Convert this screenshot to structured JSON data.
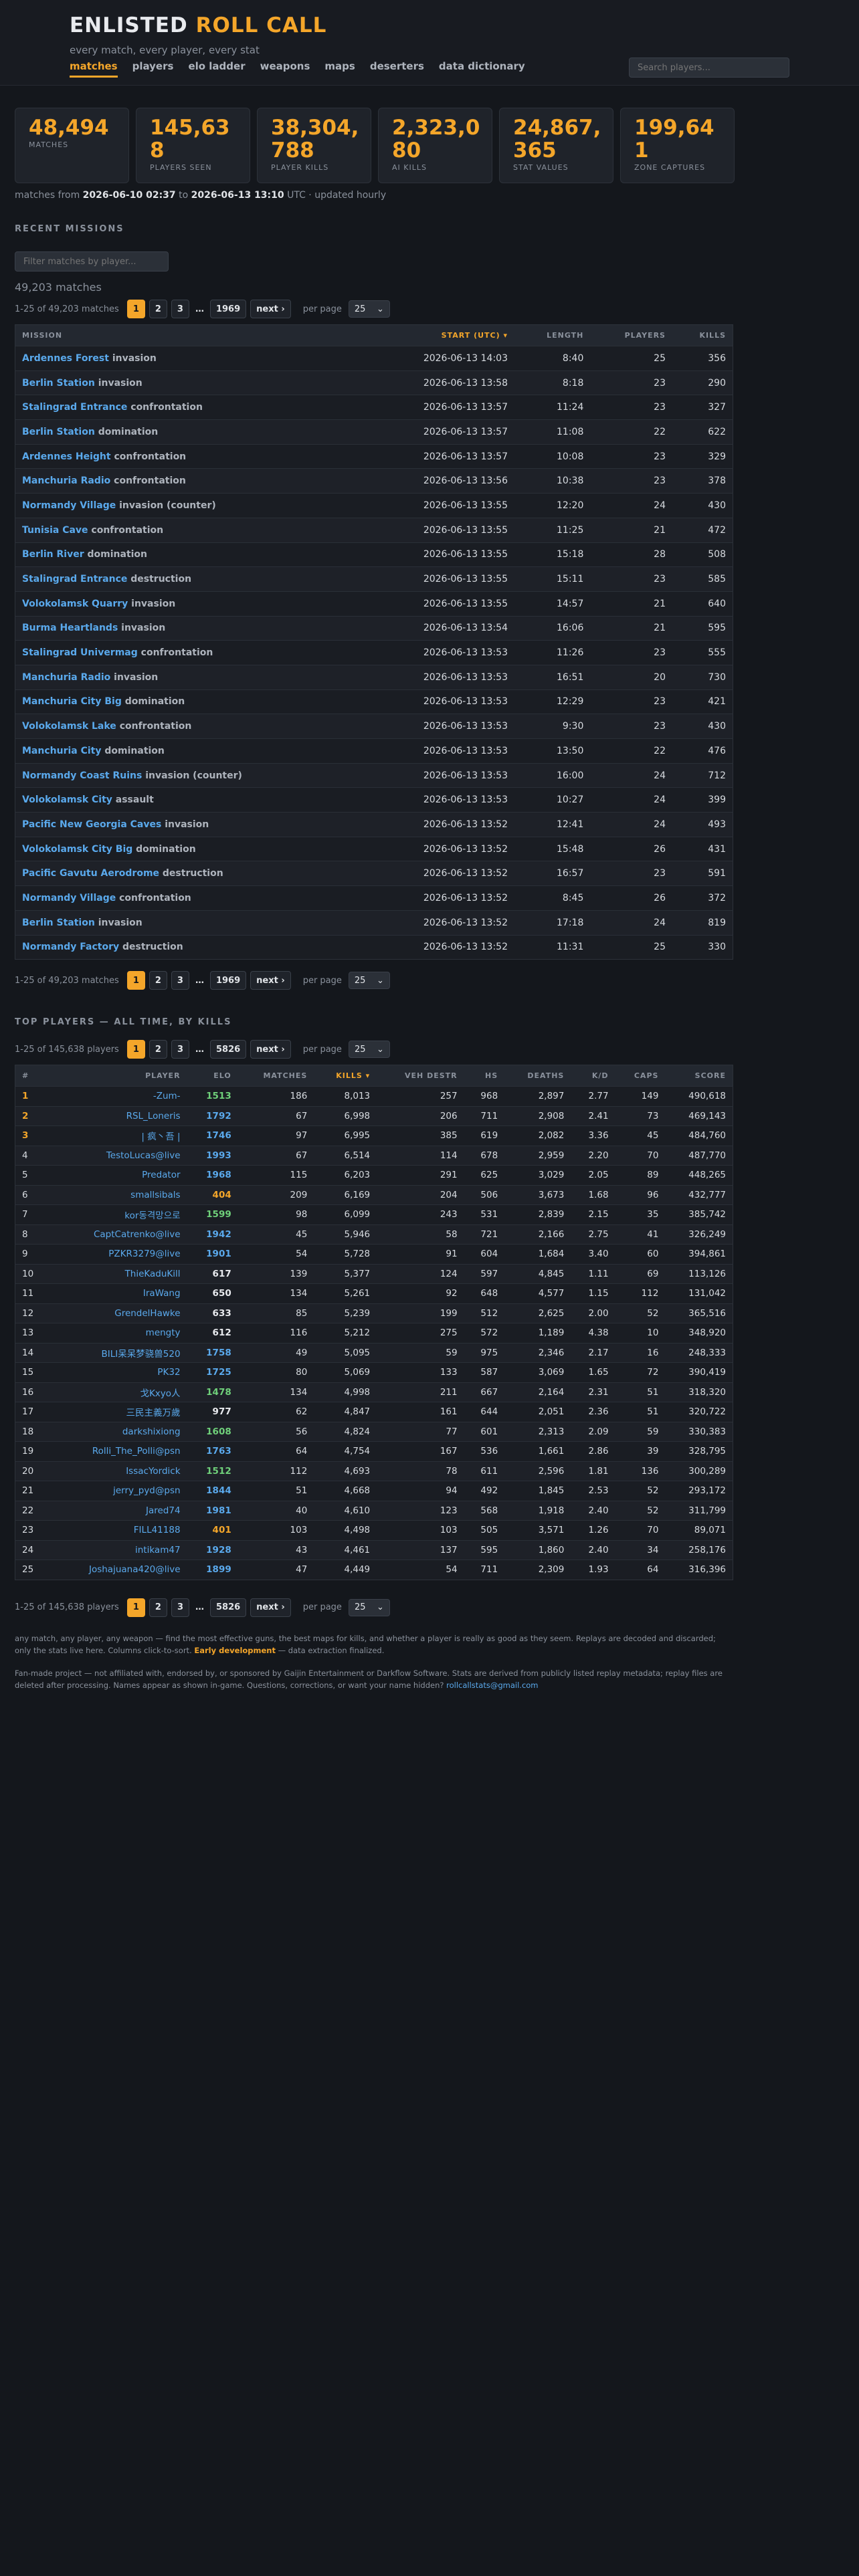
{
  "header": {
    "brand_a": "ENLISTED",
    "brand_b": "ROLL CALL",
    "tagline": "every match, every player, every stat",
    "nav": [
      "matches",
      "players",
      "elo ladder",
      "weapons",
      "maps",
      "deserters",
      "data dictionary"
    ],
    "search_placeholder": "Search players..."
  },
  "stats": [
    {
      "value": "48,494",
      "label": "MATCHES"
    },
    {
      "value": "145,638",
      "label": "PLAYERS SEEN"
    },
    {
      "value": "38,304,788",
      "label": "PLAYER KILLS"
    },
    {
      "value": "2,323,080",
      "label": "AI KILLS"
    },
    {
      "value": "24,867,365",
      "label": "STAT VALUES"
    },
    {
      "value": "199,641",
      "label": "ZONE CAPTURES"
    }
  ],
  "range": {
    "prefix": "matches from",
    "from": "2026-06-10 02:37",
    "mid": "to",
    "to": "2026-06-13 13:10",
    "suffix": "UTC · updated hourly"
  },
  "recent": {
    "title": "RECENT MISSIONS",
    "filter_placeholder": "Filter matches by player...",
    "count": "49,203 matches",
    "pager_text": "1-25 of 49,203 matches",
    "pages": [
      "1",
      "2",
      "3",
      "…",
      "1969",
      "next ›"
    ],
    "per_page_label": "per page",
    "per_page": "25",
    "columns": [
      "MISSION",
      "START (UTC) ▾",
      "LENGTH",
      "PLAYERS",
      "KILLS"
    ],
    "rows": [
      [
        "Ardennes Forest",
        "invasion",
        "2026-06-13 14:03",
        "8:40",
        "25",
        "356"
      ],
      [
        "Berlin Station",
        "invasion",
        "2026-06-13 13:58",
        "8:18",
        "23",
        "290"
      ],
      [
        "Stalingrad Entrance",
        "confrontation",
        "2026-06-13 13:57",
        "11:24",
        "23",
        "327"
      ],
      [
        "Berlin Station",
        "domination",
        "2026-06-13 13:57",
        "11:08",
        "22",
        "622"
      ],
      [
        "Ardennes Height",
        "confrontation",
        "2026-06-13 13:57",
        "10:08",
        "23",
        "329"
      ],
      [
        "Manchuria Radio",
        "confrontation",
        "2026-06-13 13:56",
        "10:38",
        "23",
        "378"
      ],
      [
        "Normandy Village",
        "invasion (counter)",
        "2026-06-13 13:55",
        "12:20",
        "24",
        "430"
      ],
      [
        "Tunisia Cave",
        "confrontation",
        "2026-06-13 13:55",
        "11:25",
        "21",
        "472"
      ],
      [
        "Berlin River",
        "domination",
        "2026-06-13 13:55",
        "15:18",
        "28",
        "508"
      ],
      [
        "Stalingrad Entrance",
        "destruction",
        "2026-06-13 13:55",
        "15:11",
        "23",
        "585"
      ],
      [
        "Volokolamsk Quarry",
        "invasion",
        "2026-06-13 13:55",
        "14:57",
        "21",
        "640"
      ],
      [
        "Burma Heartlands",
        "invasion",
        "2026-06-13 13:54",
        "16:06",
        "21",
        "595"
      ],
      [
        "Stalingrad Univermag",
        "confrontation",
        "2026-06-13 13:53",
        "11:26",
        "23",
        "555"
      ],
      [
        "Manchuria Radio",
        "invasion",
        "2026-06-13 13:53",
        "16:51",
        "20",
        "730"
      ],
      [
        "Manchuria City Big",
        "domination",
        "2026-06-13 13:53",
        "12:29",
        "23",
        "421"
      ],
      [
        "Volokolamsk Lake",
        "confrontation",
        "2026-06-13 13:53",
        "9:30",
        "23",
        "430"
      ],
      [
        "Manchuria City",
        "domination",
        "2026-06-13 13:53",
        "13:50",
        "22",
        "476"
      ],
      [
        "Normandy Coast Ruins",
        "invasion (counter)",
        "2026-06-13 13:53",
        "16:00",
        "24",
        "712"
      ],
      [
        "Volokolamsk City",
        "assault",
        "2026-06-13 13:53",
        "10:27",
        "24",
        "399"
      ],
      [
        "Pacific New Georgia Caves",
        "invasion",
        "2026-06-13 13:52",
        "12:41",
        "24",
        "493"
      ],
      [
        "Volokolamsk City Big",
        "domination",
        "2026-06-13 13:52",
        "15:48",
        "26",
        "431"
      ],
      [
        "Pacific Gavutu Aerodrome",
        "destruction",
        "2026-06-13 13:52",
        "16:57",
        "23",
        "591"
      ],
      [
        "Normandy Village",
        "confrontation",
        "2026-06-13 13:52",
        "8:45",
        "26",
        "372"
      ],
      [
        "Berlin Station",
        "invasion",
        "2026-06-13 13:52",
        "17:18",
        "24",
        "819"
      ],
      [
        "Normandy Factory",
        "destruction",
        "2026-06-13 13:52",
        "11:31",
        "25",
        "330"
      ]
    ]
  },
  "top": {
    "title": "TOP PLAYERS — ALL TIME, BY KILLS",
    "pager_text": "1-25 of 145,638 players",
    "pages": [
      "1",
      "2",
      "3",
      "…",
      "5826",
      "next ›"
    ],
    "per_page_label": "per page",
    "per_page": "25",
    "columns": [
      "#",
      "PLAYER",
      "ELO",
      "MATCHES",
      "KILLS ▾",
      "VEH DESTR",
      "HS",
      "DEATHS",
      "K/D",
      "CAPS",
      "SCORE"
    ],
    "elo_colors": {
      "blue": "#5aa9ec",
      "white": "#e8eaee",
      "green": "#6fd07a",
      "orange": "#f4a62a"
    },
    "rows": [
      [
        "1",
        "-Zum-",
        "1513",
        "green",
        "186",
        "8,013",
        "257",
        "968",
        "2,897",
        "2.77",
        "149",
        "490,618"
      ],
      [
        "2",
        "RSL_Loneris",
        "1792",
        "blue",
        "67",
        "6,998",
        "206",
        "711",
        "2,908",
        "2.41",
        "73",
        "469,143"
      ],
      [
        "3",
        "| 疯丶吾 |",
        "1746",
        "blue",
        "97",
        "6,995",
        "385",
        "619",
        "2,082",
        "3.36",
        "45",
        "484,760"
      ],
      [
        "4",
        "TestoLucas@live",
        "1993",
        "blue",
        "67",
        "6,514",
        "114",
        "678",
        "2,959",
        "2.20",
        "70",
        "487,770"
      ],
      [
        "5",
        "Predator",
        "1968",
        "blue",
        "115",
        "6,203",
        "291",
        "625",
        "3,029",
        "2.05",
        "89",
        "448,265"
      ],
      [
        "6",
        "smallsibals",
        "404",
        "orange",
        "209",
        "6,169",
        "204",
        "506",
        "3,673",
        "1.68",
        "96",
        "432,777"
      ],
      [
        "7",
        "kor동격망으로",
        "1599",
        "green",
        "98",
        "6,099",
        "243",
        "531",
        "2,839",
        "2.15",
        "35",
        "385,742"
      ],
      [
        "8",
        "CaptCatrenko@live",
        "1942",
        "blue",
        "45",
        "5,946",
        "58",
        "721",
        "2,166",
        "2.75",
        "41",
        "326,249"
      ],
      [
        "9",
        "PZKR3279@live",
        "1901",
        "blue",
        "54",
        "5,728",
        "91",
        "604",
        "1,684",
        "3.40",
        "60",
        "394,861"
      ],
      [
        "10",
        "ThieKaduKill",
        "617",
        "white",
        "139",
        "5,377",
        "124",
        "597",
        "4,845",
        "1.11",
        "69",
        "113,126"
      ],
      [
        "11",
        "IraWang",
        "650",
        "white",
        "134",
        "5,261",
        "92",
        "648",
        "4,577",
        "1.15",
        "112",
        "131,042"
      ],
      [
        "12",
        "GrendelHawke",
        "633",
        "white",
        "85",
        "5,239",
        "199",
        "512",
        "2,625",
        "2.00",
        "52",
        "365,516"
      ],
      [
        "13",
        "mengty",
        "612",
        "white",
        "116",
        "5,212",
        "275",
        "572",
        "1,189",
        "4.38",
        "10",
        "348,920"
      ],
      [
        "14",
        "BILI呆呆梦骁兽520",
        "1758",
        "blue",
        "49",
        "5,095",
        "59",
        "975",
        "2,346",
        "2.17",
        "16",
        "248,333"
      ],
      [
        "15",
        "PK32",
        "1725",
        "blue",
        "80",
        "5,069",
        "133",
        "587",
        "3,069",
        "1.65",
        "72",
        "390,419"
      ],
      [
        "16",
        "戈Kxyo人",
        "1478",
        "green",
        "134",
        "4,998",
        "211",
        "667",
        "2,164",
        "2.31",
        "51",
        "318,320"
      ],
      [
        "17",
        "三民主義万歲",
        "977",
        "white",
        "62",
        "4,847",
        "161",
        "644",
        "2,051",
        "2.36",
        "51",
        "320,722"
      ],
      [
        "18",
        "darkshixiong",
        "1608",
        "green",
        "56",
        "4,824",
        "77",
        "601",
        "2,313",
        "2.09",
        "59",
        "330,383"
      ],
      [
        "19",
        "Rolli_The_Polli@psn",
        "1763",
        "blue",
        "64",
        "4,754",
        "167",
        "536",
        "1,661",
        "2.86",
        "39",
        "328,795"
      ],
      [
        "20",
        "IssacYordick",
        "1512",
        "green",
        "112",
        "4,693",
        "78",
        "611",
        "2,596",
        "1.81",
        "136",
        "300,289"
      ],
      [
        "21",
        "jerry_pyd@psn",
        "1844",
        "blue",
        "51",
        "4,668",
        "94",
        "492",
        "1,845",
        "2.53",
        "52",
        "293,172"
      ],
      [
        "22",
        "Jared74",
        "1981",
        "blue",
        "40",
        "4,610",
        "123",
        "568",
        "1,918",
        "2.40",
        "52",
        "311,799"
      ],
      [
        "23",
        "FILL41188",
        "401",
        "orange",
        "103",
        "4,498",
        "103",
        "505",
        "3,571",
        "1.26",
        "70",
        "89,071"
      ],
      [
        "24",
        "intikam47",
        "1928",
        "blue",
        "43",
        "4,461",
        "137",
        "595",
        "1,860",
        "2.40",
        "34",
        "258,176"
      ],
      [
        "25",
        "Joshajuana420@live",
        "1899",
        "blue",
        "47",
        "4,449",
        "54",
        "711",
        "2,309",
        "1.93",
        "64",
        "316,396"
      ]
    ]
  },
  "footer": {
    "line1": "any match, any player, any weapon — find the most effective guns, the best maps for kills, and whether a player is really as good as they seem. Replays are decoded and discarded; only the stats live here. Columns click-to-sort.",
    "line1_hl": "Early development",
    "line1_end": "— data extraction finalized.",
    "line2": "Fan-made project — not affiliated with, endorsed by, or sponsored by Gaijin Entertainment or Darkflow Software. Stats are derived from publicly listed replay metadata; replay files are deleted after processing. Names appear as shown in-game. Questions, corrections, or want your name hidden?",
    "email": "rollcallstats@gmail.com"
  }
}
